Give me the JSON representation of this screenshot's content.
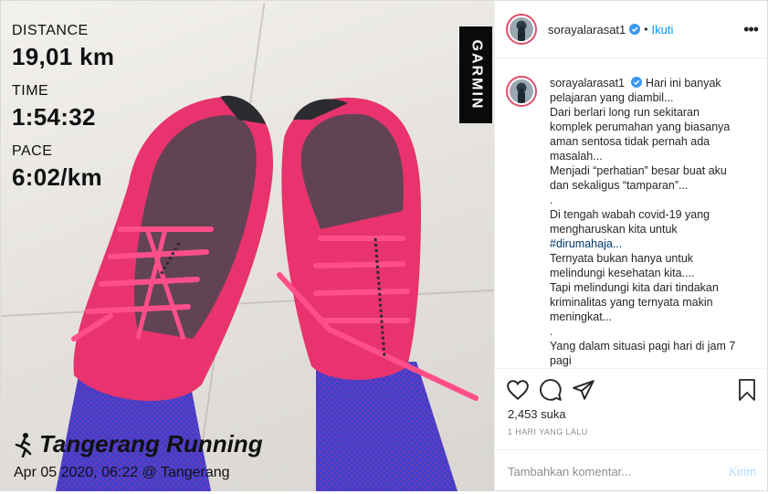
{
  "photo": {
    "stats": [
      {
        "label": "DISTANCE",
        "value": "19,01",
        "unit": "km"
      },
      {
        "label": "TIME",
        "value": "1:54:32",
        "unit": ""
      },
      {
        "label": "PACE",
        "value": "6:02/km",
        "unit": ""
      }
    ],
    "garmin_text": "GARMIN",
    "activity_title": "Tangerang Running",
    "activity_meta": "Apr 05 2020, 06:22 @ Tangerang",
    "shoe_color": "#e8336e",
    "sock_color": "#3a3fd0"
  },
  "header": {
    "username": "sorayalarasat1",
    "separator": "•",
    "follow_label": "Ikuti",
    "more_label": "•••"
  },
  "caption": {
    "username": "sorayalarasat1",
    "lines": [
      "Hari ini banyak",
      "pelajaran yang diambil...",
      "Dari berlari long run sekitaran",
      "komplek perumahan yang biasanya",
      "aman sentosa tidak pernah ada",
      "masalah...",
      "Menjadi “perhatian” besar buat aku",
      "dan sekaligus “tamparan”...",
      ".",
      "Di tengah wabah covid-19 yang",
      "mengharuskan kita untuk",
      "#dirumahaja...",
      "Ternyata bukan hanya untuk",
      "melindungi kesehatan kita....",
      "Tapi melindungi kita dari tindakan",
      "kriminalitas yang ternyata makin",
      "meningkat...",
      ".",
      "Yang dalam situasi pagi hari di jam 7",
      "pagi"
    ]
  },
  "actions": {
    "likes": "2,453 suka",
    "time_ago": "1 HARI YANG LALU",
    "comment_placeholder": "Tambahkan komentar...",
    "post_label": "Kirim"
  },
  "colors": {
    "accent": "#0095f6",
    "verified": "#3897f0",
    "hashtag": "#00376b",
    "border": "#dbdbdb"
  }
}
